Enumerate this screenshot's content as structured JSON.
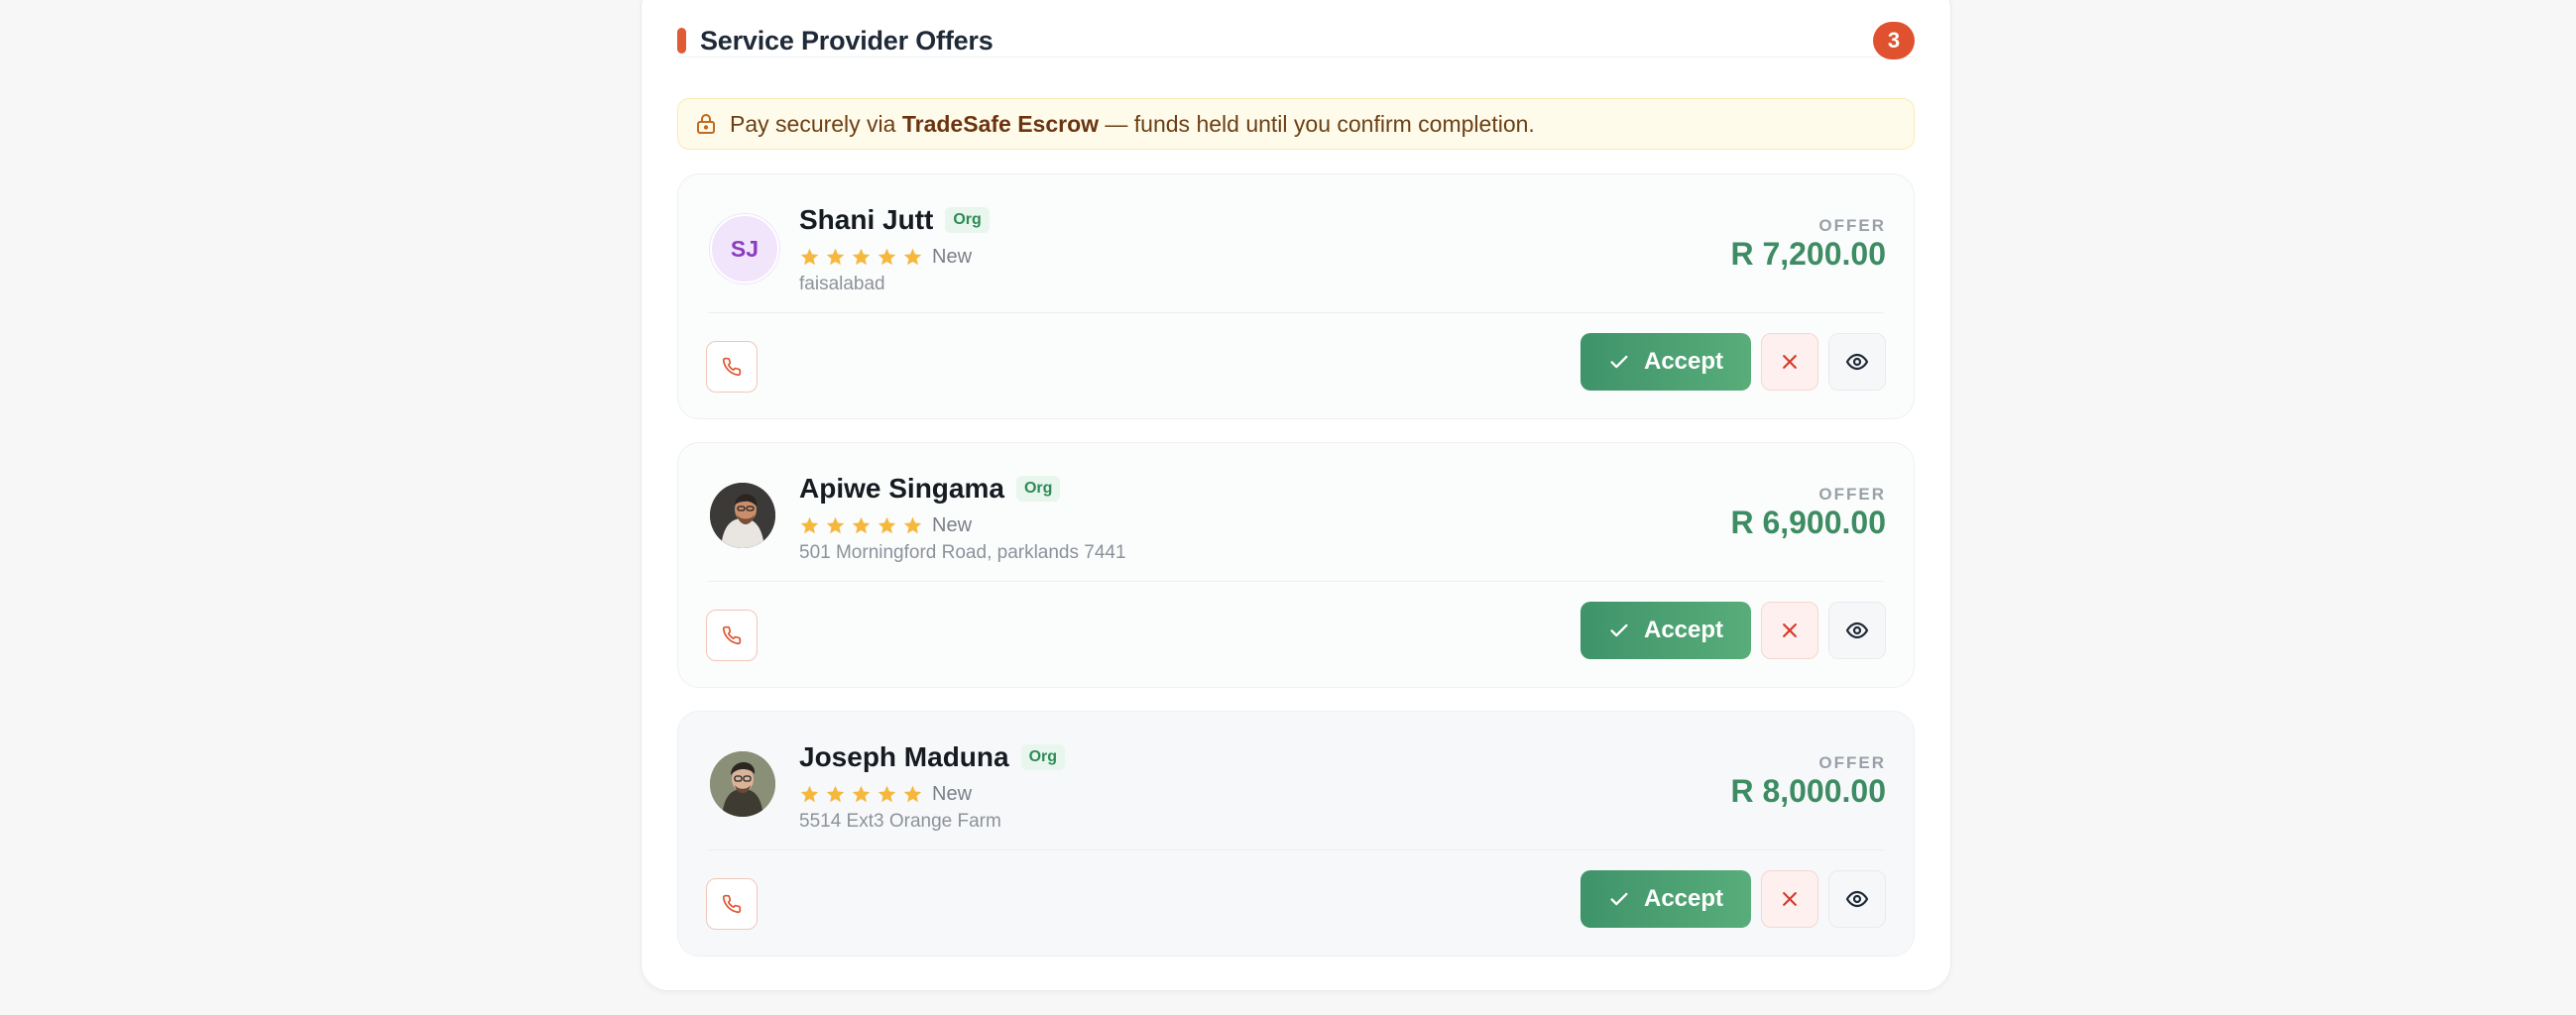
{
  "header": {
    "title": "Service Provider Offers",
    "count": "3"
  },
  "notice": {
    "prefix": "Pay securely via ",
    "brand": "TradeSafe Escrow",
    "suffix": " — funds held until you confirm completion."
  },
  "colors": {
    "accent": "#e0522f",
    "offer_price": "#3d8c63",
    "accept": "#4aa06f",
    "star": "#f5b83d"
  },
  "offer_label": "OFFER",
  "accept_label": "Accept",
  "offers": [
    {
      "name": "Shani Jutt",
      "badge": "Org",
      "rating": 5,
      "rating_label": "New",
      "location": "faisalabad",
      "price": "R 7,200.00",
      "avatar": "SJ"
    },
    {
      "name": "Apiwe Singama",
      "badge": "Org",
      "rating": 5,
      "rating_label": "New",
      "location": "501 Morningford Road, parklands 7441",
      "price": "R 6,900.00",
      "avatar": "photo"
    },
    {
      "name": "Joseph Maduna",
      "badge": "Org",
      "rating": 5,
      "rating_label": "New",
      "location": "5514 Ext3 Orange Farm",
      "price": "R 8,000.00",
      "avatar": "photo"
    }
  ]
}
